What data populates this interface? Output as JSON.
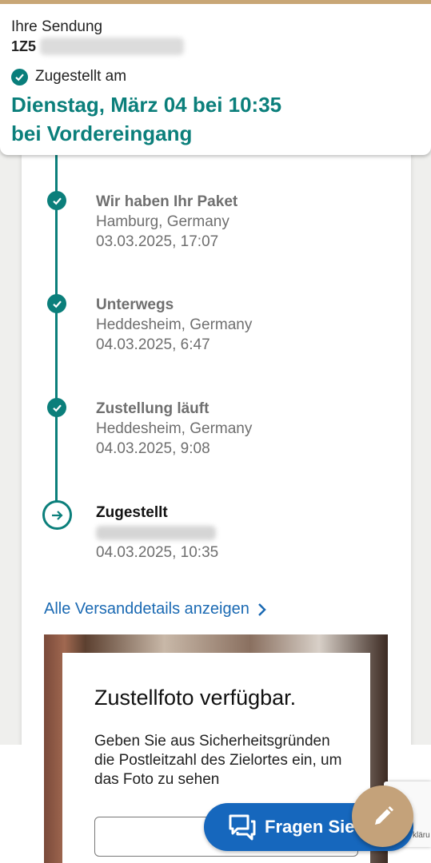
{
  "header": {
    "label": "Ihre Sendung",
    "tracking_prefix": "1Z5",
    "status_label": "Zugestellt am",
    "delivery_date": "Dienstag, März 04 bei 10:35",
    "delivery_place": "bei Vordereingang"
  },
  "timeline": [
    {
      "title": "Wir haben Ihr Paket",
      "location": "Hamburg, Germany",
      "time": "03.03.2025, 17:07",
      "state": "done"
    },
    {
      "title": "Unterwegs",
      "location": "Heddesheim, Germany",
      "time": "04.03.2025, 6:47",
      "state": "done"
    },
    {
      "title": "Zustellung läuft",
      "location": "Heddesheim, Germany",
      "time": "04.03.2025, 9:08",
      "state": "done"
    },
    {
      "title": "Zugestellt",
      "location": "",
      "time": "04.03.2025, 10:35",
      "state": "current"
    }
  ],
  "details_link": "Alle Versanddetails anzeigen",
  "photo": {
    "title": "Zustellfoto verfügbar.",
    "text": "Geben Sie aus Sicherheitsgründen die Postleitzahl des Zielortes ein, um das Foto zu sehen",
    "input_value": ""
  },
  "recaptcha_text": "kläru",
  "ask_button": {
    "label": "Fragen Sie",
    "icon": "chat-bubble-icon"
  },
  "fab_icon": "pencil-icon",
  "colors": {
    "teal": "#0b7f7b",
    "link": "#1b6ab3",
    "ask": "#1667bd",
    "gold": "#c4a27a"
  }
}
